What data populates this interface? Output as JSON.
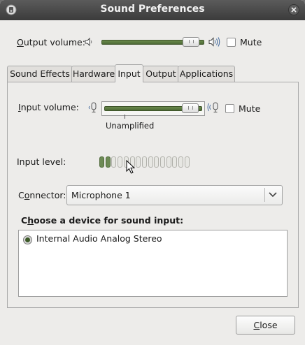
{
  "window": {
    "title": "Sound Preferences",
    "icon": "speaker-app-icon",
    "close_icon": "close-icon"
  },
  "output": {
    "label_prefix": "",
    "label_mnemonic": "O",
    "label_rest": "utput volume:",
    "level": 0.96,
    "mute_label": "Mute",
    "mute_checked": false
  },
  "tabs": [
    {
      "label": "Sound Effects",
      "active": false
    },
    {
      "label": "Hardware",
      "active": false
    },
    {
      "label": "Input",
      "active": true
    },
    {
      "label": "Output",
      "active": false
    },
    {
      "label": "Applications",
      "active": false
    }
  ],
  "input": {
    "volume_label_mnemonic": "I",
    "volume_label_rest": "nput volume:",
    "level": 0.97,
    "mark_label": "Unamplified",
    "mute_label": "Mute",
    "mute_checked": false,
    "level_label": "Input level:",
    "level_segments_total": 15,
    "level_segments_on": 2,
    "connector_prefix": "C",
    "connector_mnemonic": "o",
    "connector_rest": "nnector:",
    "connector_value": "Microphone 1",
    "device_heading_prefix": "C",
    "device_heading_mnemonic": "h",
    "device_heading_rest": "oose a device for sound input:",
    "devices": [
      {
        "label": "Internal Audio Analog Stereo",
        "selected": true
      }
    ]
  },
  "close_button": {
    "mnemonic": "C",
    "rest": "lose"
  },
  "colors": {
    "accent": "#5a7a3f",
    "titlebar": "#4a4a4a"
  }
}
